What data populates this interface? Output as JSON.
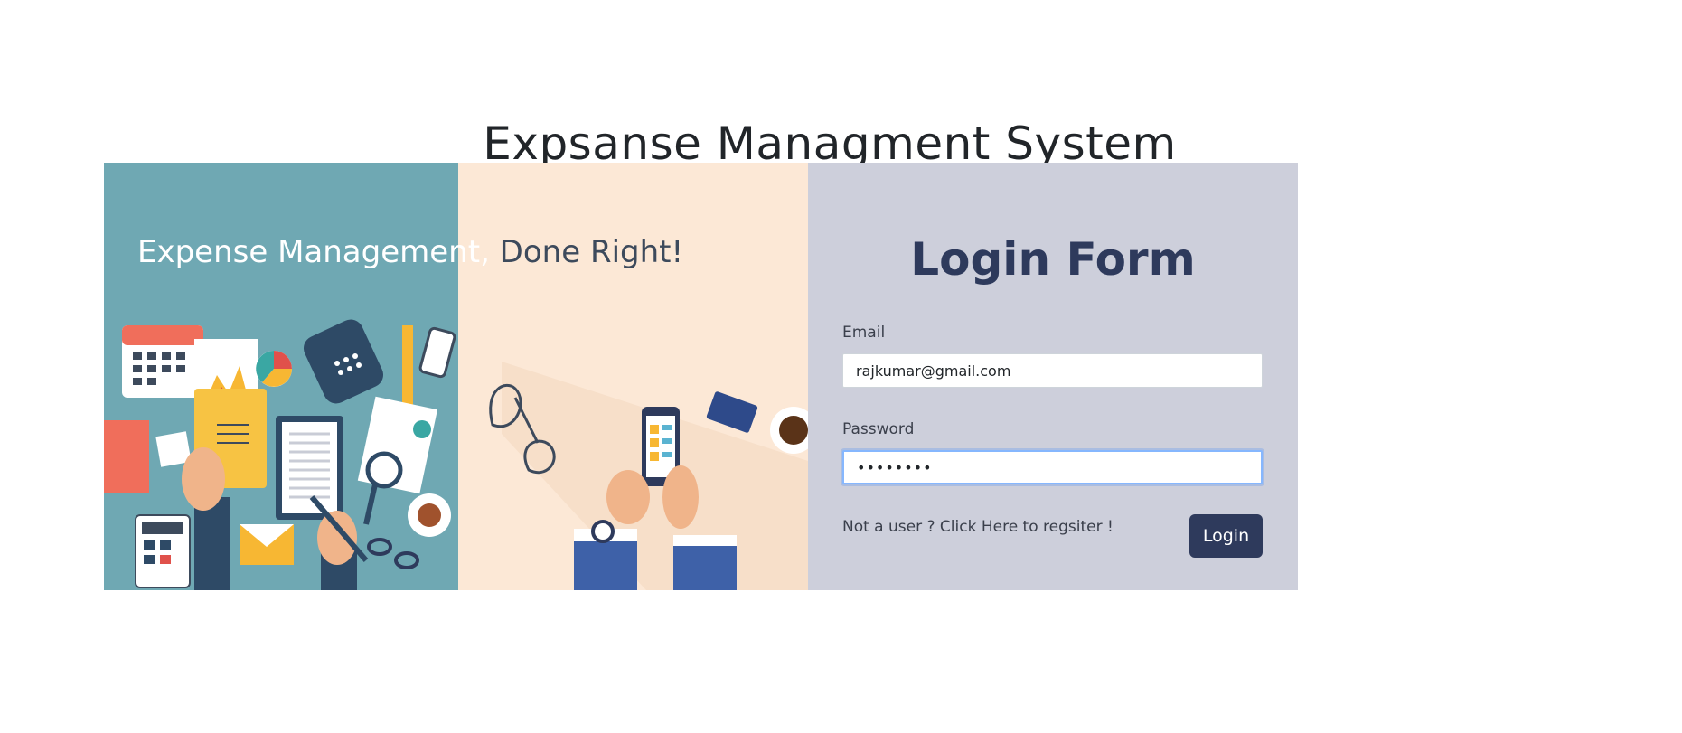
{
  "page": {
    "title": "Expsanse Managment System"
  },
  "hero": {
    "headline_part1": "Expense Management,",
    "headline_part2": " Done Right!",
    "image_semantic": "expense-management-illustration"
  },
  "login_form": {
    "title": "Login Form",
    "email_label": "Email",
    "email_value": "rajkumar@gmail.com",
    "password_label": "Password",
    "password_value": "••••••••",
    "register_text": "Not a user ? Click Here to regsiter !",
    "login_label": "Login"
  },
  "colors": {
    "form_panel_bg": "#cdcfdb",
    "primary": "#2e3a5c",
    "hero_teal": "#6fa8b3",
    "hero_peach": "#fce8d6",
    "focus_border": "#86b7fe"
  }
}
